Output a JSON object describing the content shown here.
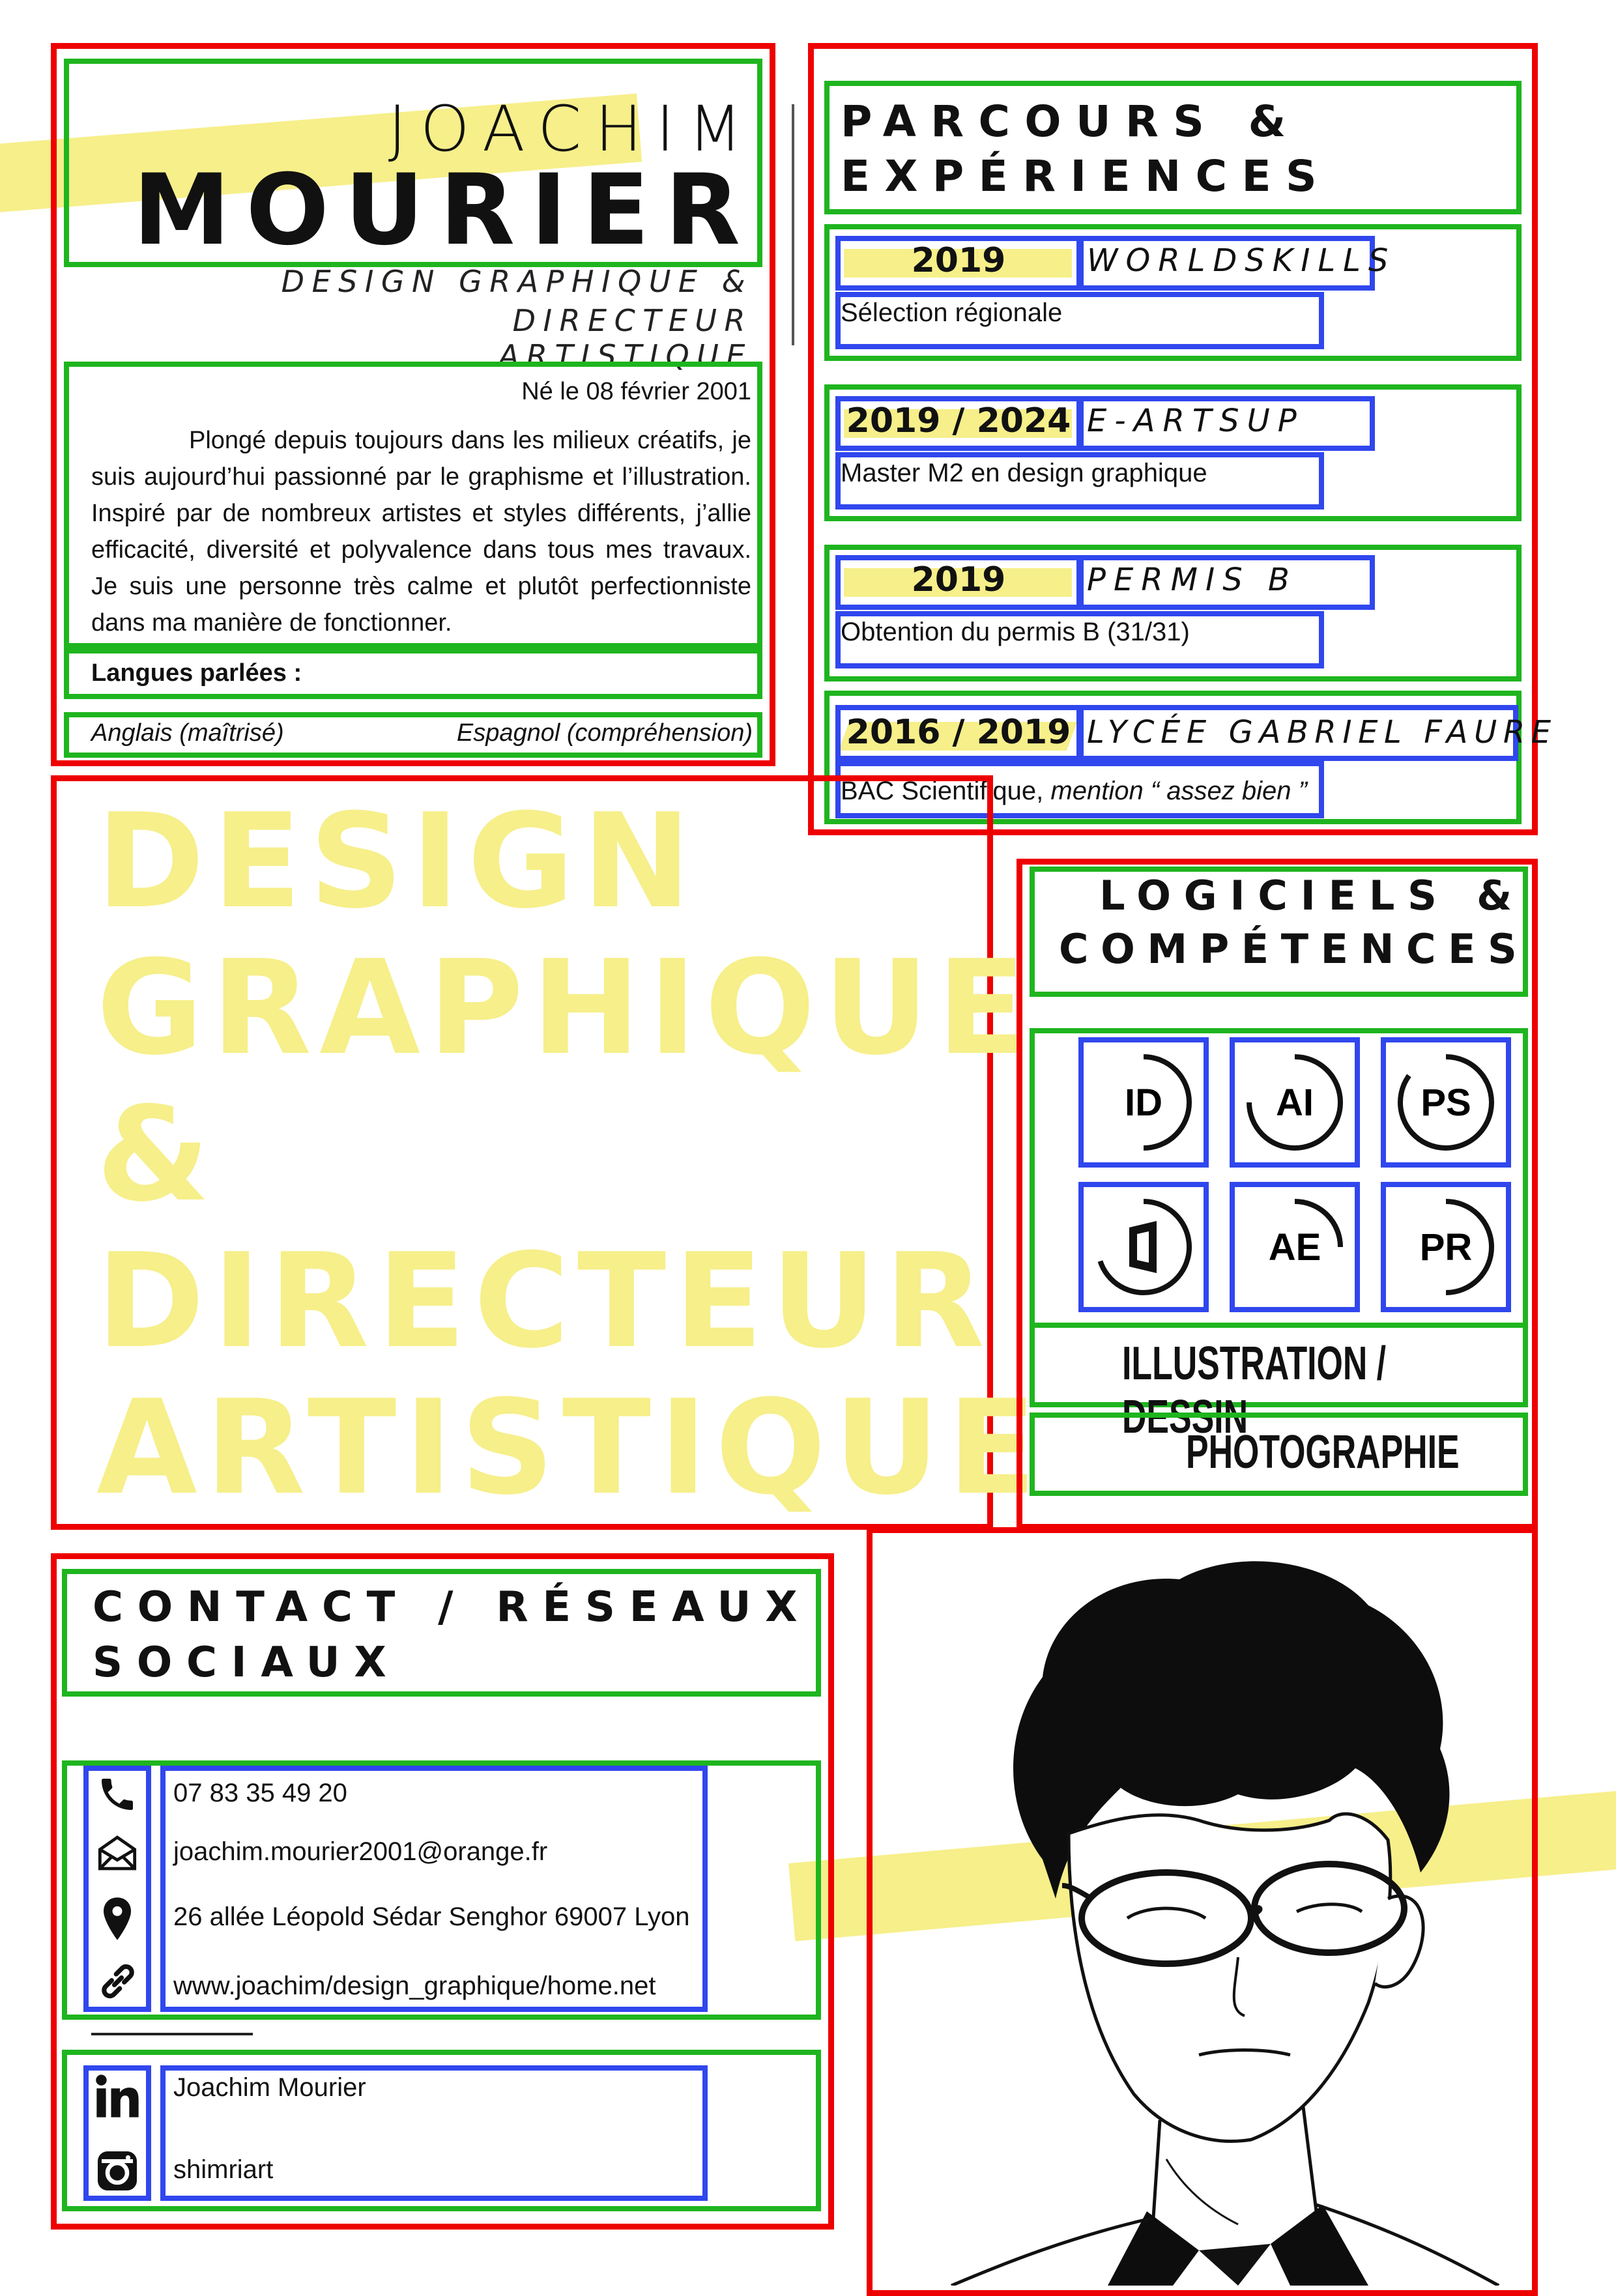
{
  "header": {
    "first_name": "JOACHIM",
    "last_name": "MOURIER",
    "title_line1": "DESIGN GRAPHIQUE &",
    "title_line2": "DIRECTEUR ARTISTIQUE"
  },
  "profile": {
    "birth": "Né le 08 février 2001",
    "bio": "Plongé depuis toujours dans les milieux créatifs, je suis aujourd’hui passionné par le graphisme et l’illustration. Inspiré par de nombreux artistes et styles différents, j’allie efficacité, diversité et polyvalence dans tous mes travaux. Je suis une personne très calme et plutôt perfectionniste dans ma manière de fonctionner.",
    "languages_title": "Langues parlées :",
    "language_1": "Anglais (maîtrisé)",
    "language_2": "Espagnol (compréhension)"
  },
  "experience": {
    "title_line1": "PARCOURS &",
    "title_line2": "EXPÉRIENCES",
    "items": [
      {
        "years": "2019",
        "name": "WORLDSKILLS",
        "detail": "Sélection régionale"
      },
      {
        "years": "2019 / 2024",
        "name": "E-ARTSUP",
        "detail": "Master M2 en design graphique"
      },
      {
        "years": "2019",
        "name": "PERMIS B",
        "detail": "Obtention du permis B (31/31)"
      },
      {
        "years": "2016 / 2019",
        "name": "LYCÉE GABRIEL FAURE",
        "detail": "BAC Scientifique,",
        "detail_italic": "mention “ assez bien ”"
      }
    ]
  },
  "big_title": {
    "line1": "DESIGN",
    "line2": "GRAPHIQUE",
    "line3": "&",
    "line4": "DIRECTEUR",
    "line5": "ARTISTIQUE"
  },
  "skills": {
    "title_line1": "LOGICIELS &",
    "title_line2": "COMPÉTENCES",
    "software": [
      {
        "label": "ID",
        "icon": "indesign-icon",
        "level": 0.5
      },
      {
        "label": "AI",
        "icon": "illustrator-icon",
        "level": 0.75
      },
      {
        "label": "PS",
        "icon": "photoshop-icon",
        "level": 0.85
      },
      {
        "label": "",
        "icon": "office-icon",
        "level": 0.7
      },
      {
        "label": "AE",
        "icon": "after-effects-icon",
        "level": 0.25
      },
      {
        "label": "PR",
        "icon": "premiere-icon",
        "level": 0.5
      }
    ],
    "extra_1": "ILLUSTRATION / DESSIN",
    "extra_2": "PHOTOGRAPHIE"
  },
  "contact": {
    "title_line1": "CONTACT / RÉSEAUX",
    "title_line2": "SOCIAUX",
    "phone": "07 83 35 49 20",
    "email": "joachim.mourier2001@orange.fr",
    "address": "26 allée Léopold Sédar Senghor 69007 Lyon",
    "website": "www.joachim/design_graphique/home.net",
    "linkedin": "Joachim Mourier",
    "instagram": "shimriart"
  },
  "colors": {
    "accent_yellow": "#f6ef8a",
    "annotation_red": "#ee0000",
    "annotation_green": "#1fb51f",
    "annotation_blue": "#3047ee"
  }
}
